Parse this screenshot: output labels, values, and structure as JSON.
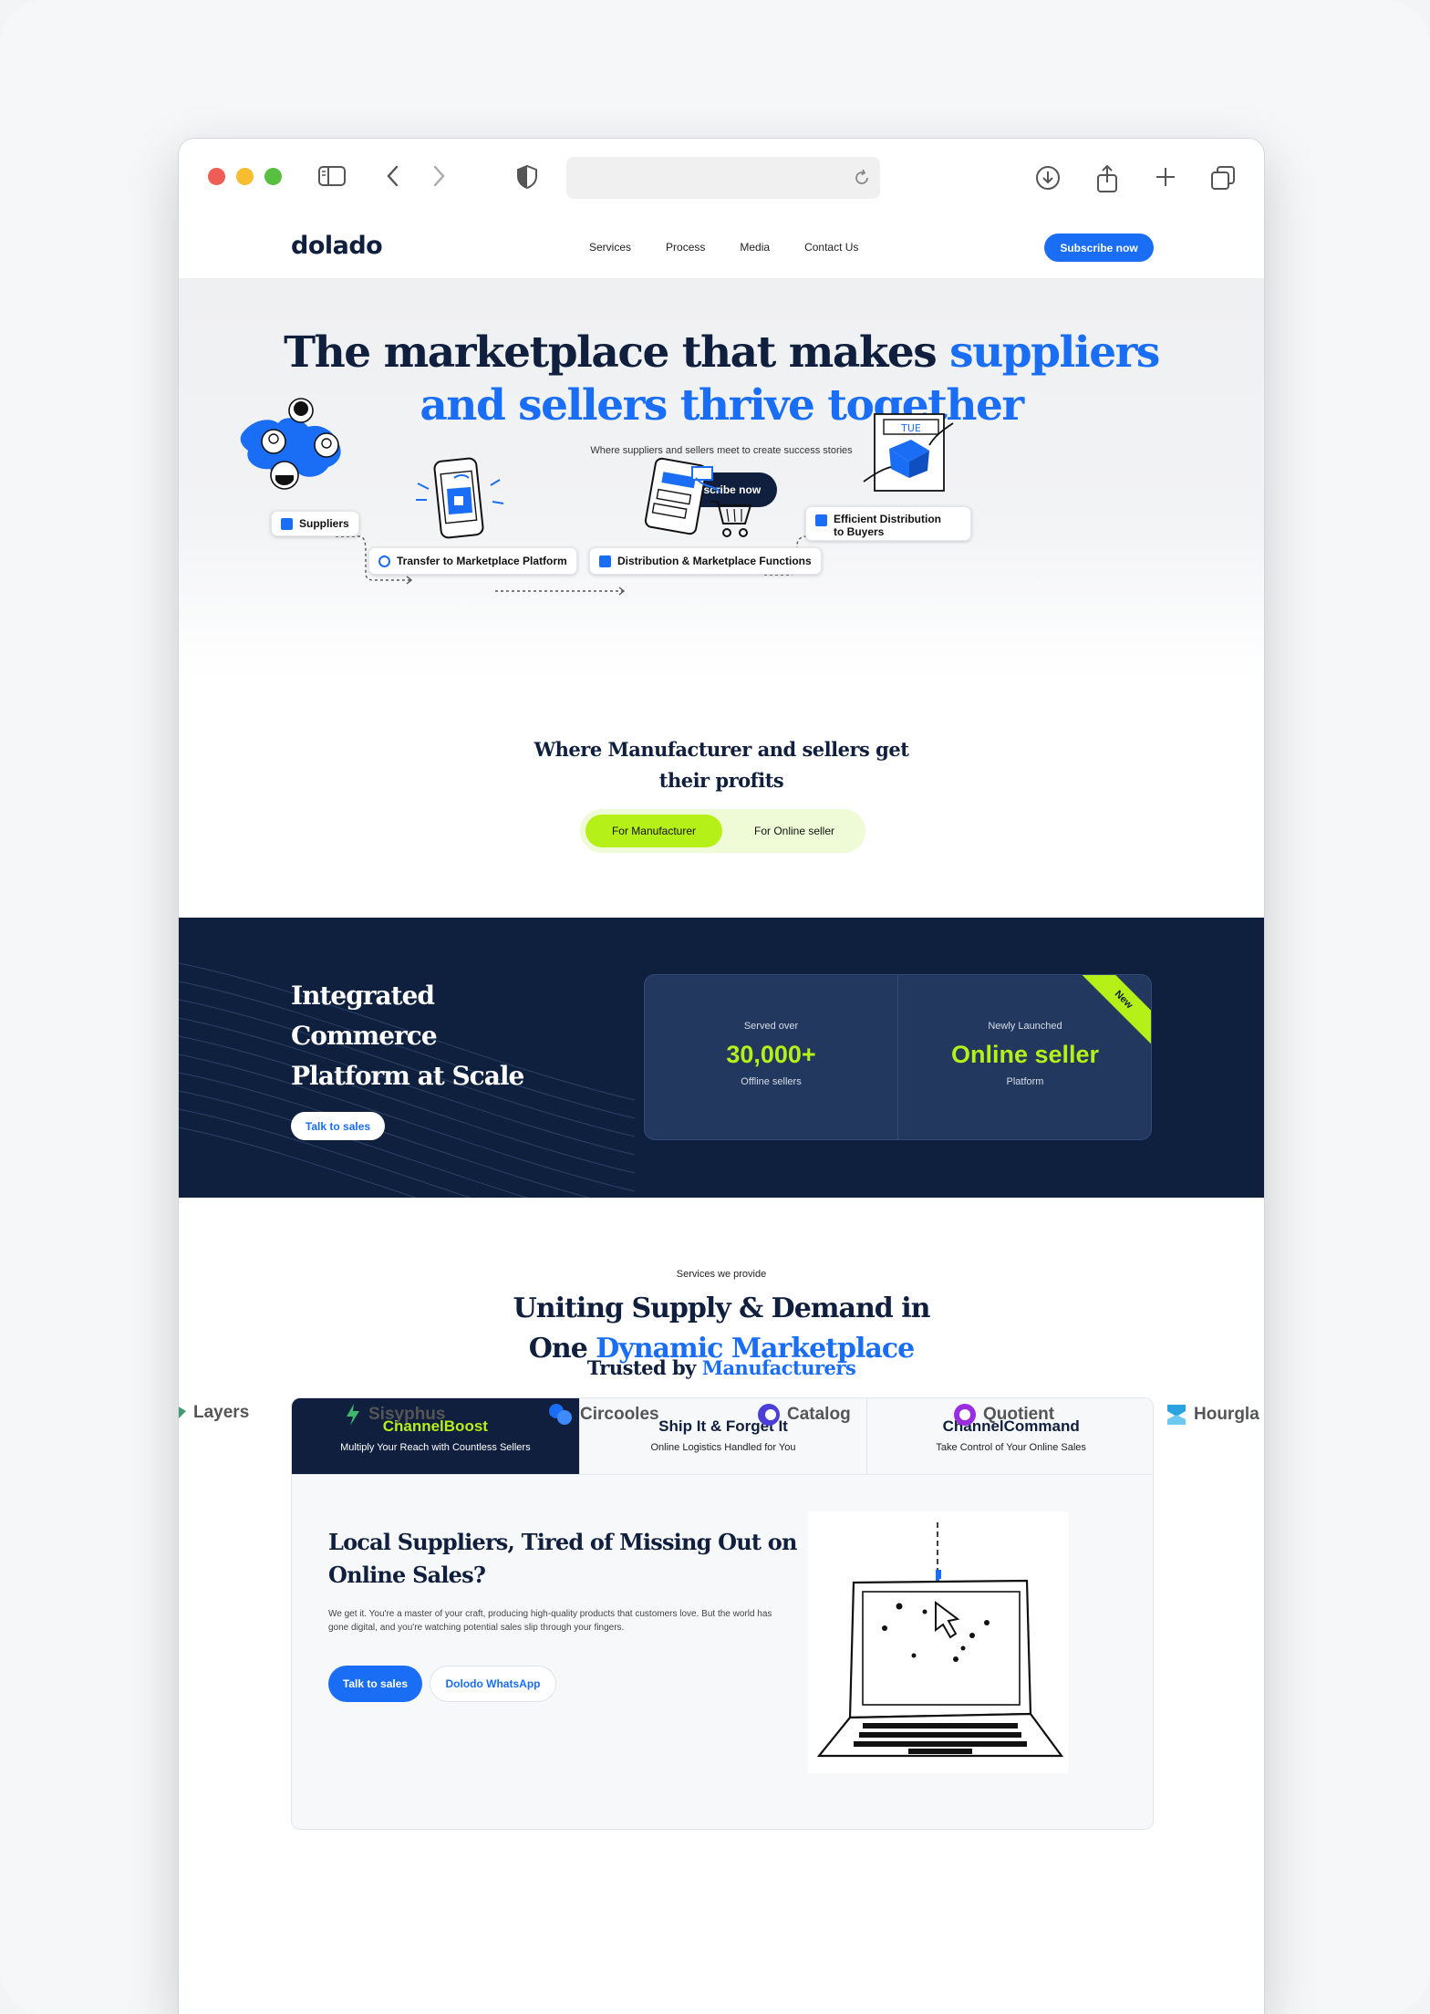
{
  "site": {
    "logo": "dolado",
    "nav": [
      "Services",
      "Process",
      "Media",
      "Contact Us"
    ],
    "subscribe_label": "Subscribe now"
  },
  "hero": {
    "title_dark": "The marketplace that makes ",
    "title_blue_1": "suppliers",
    "title_blue_2": "and sellers thrive together",
    "tagline": "Where suppliers and sellers meet to create success stories",
    "cta": "Subscribe now",
    "steps": [
      "Suppliers",
      "Transfer to Marketplace Platform",
      "Distribution & Marketplace Functions",
      "Efficient Distribution to Buyers"
    ],
    "calendar_label": "TUE"
  },
  "profits": {
    "title": "Where Manufacturer and sellers get their profits",
    "toggle": [
      "For Manufacturer",
      "For Online seller"
    ]
  },
  "platform": {
    "title": "Integrated Commerce Platform at Scale",
    "cta": "Talk to sales",
    "stats": [
      {
        "label": "Served over",
        "value": "30,000+",
        "sub": "Offline sellers"
      },
      {
        "label": "Newly Launched",
        "value": "Online seller",
        "sub": "Platform"
      }
    ],
    "ribbon": "New"
  },
  "services": {
    "eyebrow": "Services we provide",
    "title_dark_1": "Uniting Supply & Demand in",
    "title_dark_2": "One ",
    "title_blue": "Dynamic Marketplace",
    "tabs": [
      {
        "title": "ChannelBoost",
        "sub": "Multiply Your Reach with Countless Sellers"
      },
      {
        "title": "Ship It & Forget It",
        "sub": "Online Logistics Handled for You"
      },
      {
        "title": "ChannelCommand",
        "sub": "Take Control of Your Online Sales"
      }
    ],
    "panel_title": "Local Suppliers, Tired of Missing Out on Online Sales?",
    "panel_desc": "We get it. You're a master of your craft, producing high-quality products that customers love. But the world has gone digital, and you're watching potential sales slip through your fingers.",
    "btn_primary": "Talk to sales",
    "btn_secondary": "Dolodo WhatsApp"
  },
  "trusted": {
    "title_dark": "Trusted by ",
    "title_blue": "Manufacturers",
    "logos": [
      "Layers",
      "Sisyphus",
      "Circooles",
      "Catalog",
      "Quotient",
      "Hourgla"
    ]
  },
  "colors": {
    "brand_blue": "#1a6ef5",
    "navy": "#0f1f3d",
    "lime": "#b5f018"
  }
}
